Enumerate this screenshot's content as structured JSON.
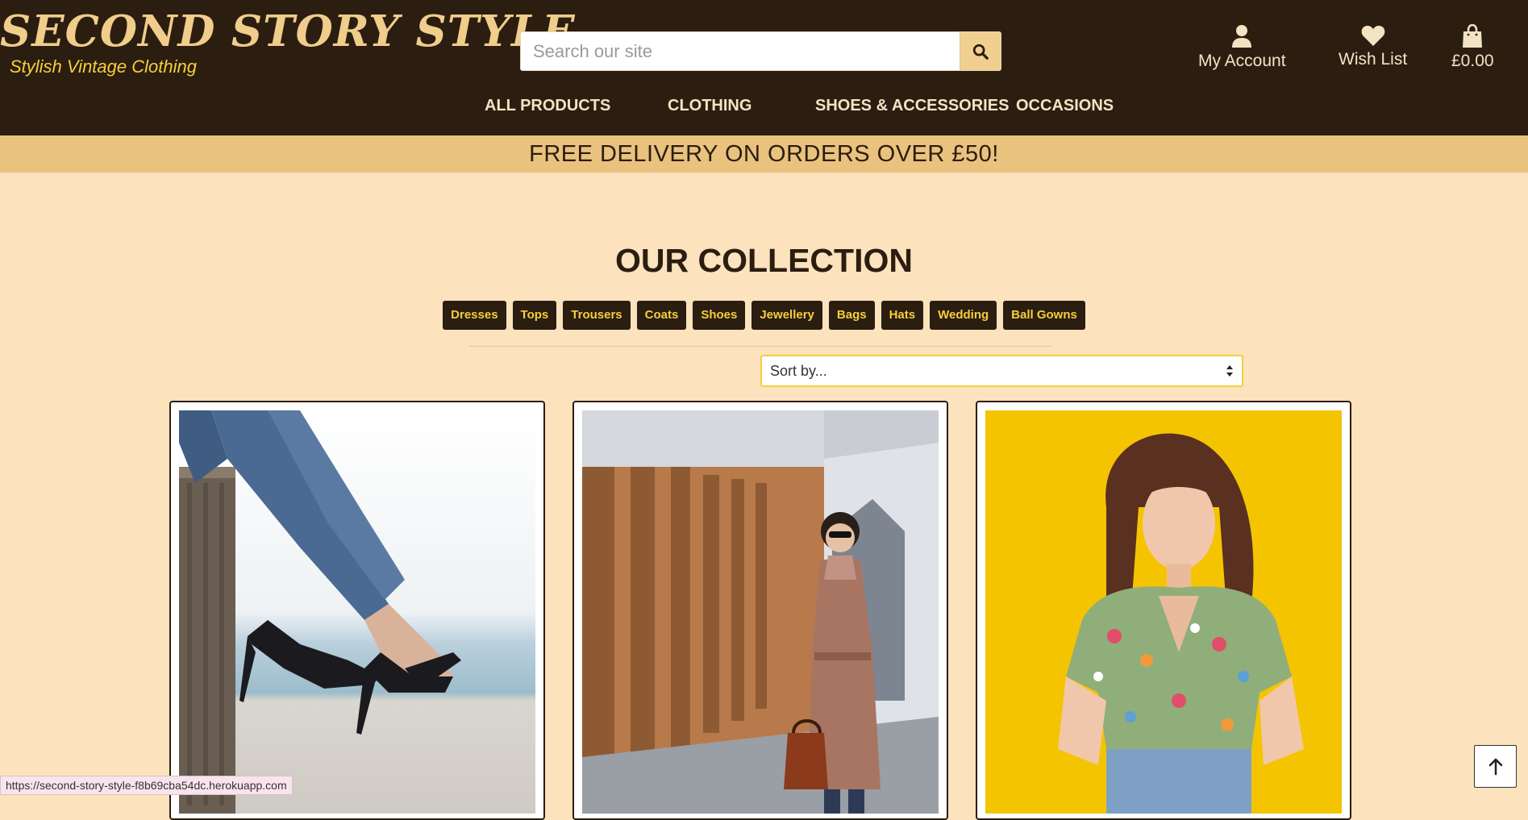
{
  "brand": {
    "title": "SECOND STORY STYLE",
    "tagline": "Stylish Vintage Clothing"
  },
  "search": {
    "placeholder": "Search our site",
    "value": ""
  },
  "header_links": {
    "account": "My Account",
    "wishlist": "Wish List",
    "cart_total": "£0.00"
  },
  "nav": {
    "items": [
      "ALL PRODUCTS",
      "CLOTHING",
      "SHOES & ACCESSORIES",
      "OCCASIONS"
    ]
  },
  "promo": "FREE DELIVERY ON ORDERS OVER £50!",
  "collection": {
    "heading": "OUR COLLECTION",
    "categories": [
      "Dresses",
      "Tops",
      "Trousers",
      "Coats",
      "Shoes",
      "Jewellery",
      "Bags",
      "Hats",
      "Wedding",
      "Ball Gowns"
    ],
    "sort_selected": "Sort by..."
  },
  "status_url": "https://second-story-style-f8b69cba54dc.herokuapp.com",
  "colors": {
    "header_bg": "#2b1d10",
    "page_bg": "#fce2bd",
    "promo_bg": "#e9c27e",
    "accent_yellow": "#f5cf3c",
    "logo_gold": "#f0cd8a"
  },
  "icons": {
    "search": "magnifier-icon",
    "account": "user-icon",
    "wishlist": "heart-icon",
    "cart": "shopping-bag-icon",
    "sort": "sort-arrows-icon",
    "back_to_top": "arrow-up-icon"
  }
}
